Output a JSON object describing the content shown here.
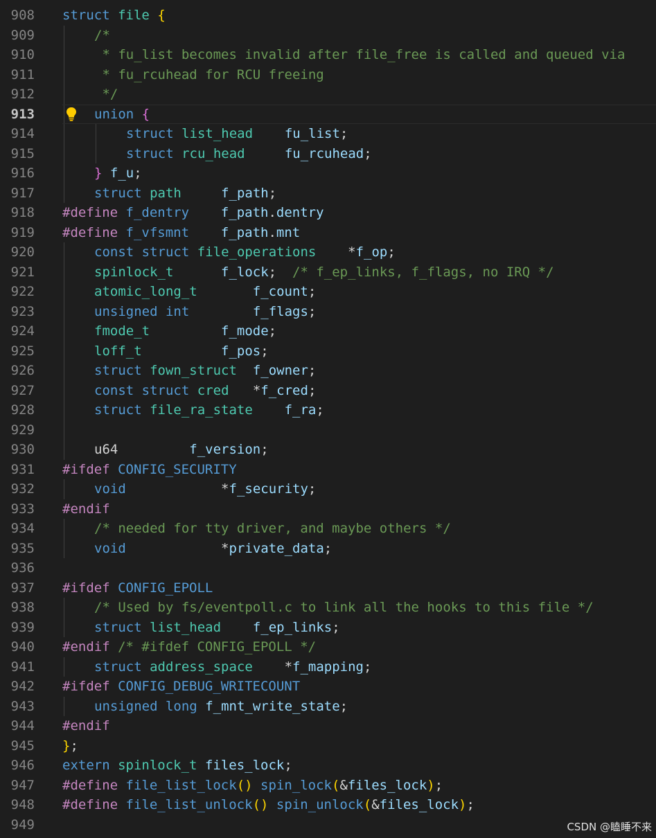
{
  "colors": {
    "background": "#1e1e1e",
    "line_number": "#858585",
    "keyword": "#569cd6",
    "type": "#4ec9b0",
    "identifier": "#9cdcfe",
    "plain": "#d4d4d4",
    "comment": "#6a9955",
    "preprocessor": "#c586c0",
    "function": "#dcdcaa",
    "bracket": "#ffd700",
    "brace_nested": "#da70d6"
  },
  "editor": {
    "current_line": "913",
    "lightbulb_icon": "lightbulb-icon",
    "lines": [
      {
        "n": "908",
        "indent": 0,
        "tokens": [
          [
            "struct",
            "k"
          ],
          [
            " ",
            "p"
          ],
          [
            "file",
            "t"
          ],
          [
            " ",
            "p"
          ],
          [
            "{",
            "b"
          ]
        ]
      },
      {
        "n": "909",
        "indent": 1,
        "tokens": [
          [
            "/*",
            "c"
          ]
        ]
      },
      {
        "n": "910",
        "indent": 1,
        "tokens": [
          [
            " * fu_list becomes invalid after file_free is called and queued via",
            "c"
          ]
        ]
      },
      {
        "n": "911",
        "indent": 1,
        "tokens": [
          [
            " * fu_rcuhead for RCU freeing",
            "c"
          ]
        ]
      },
      {
        "n": "912",
        "indent": 1,
        "tokens": [
          [
            " */",
            "c"
          ]
        ]
      },
      {
        "n": "913",
        "indent": 1,
        "tokens": [
          [
            "union",
            "k"
          ],
          [
            " ",
            "p"
          ],
          [
            "{",
            "m"
          ]
        ]
      },
      {
        "n": "914",
        "indent": 2,
        "tokens": [
          [
            "struct",
            "k"
          ],
          [
            " ",
            "p"
          ],
          [
            "list_head",
            "t"
          ],
          [
            "    ",
            "p"
          ],
          [
            "fu_list",
            "i"
          ],
          [
            ";",
            "p"
          ]
        ]
      },
      {
        "n": "915",
        "indent": 2,
        "tokens": [
          [
            "struct",
            "k"
          ],
          [
            " ",
            "p"
          ],
          [
            "rcu_head",
            "t"
          ],
          [
            "     ",
            "p"
          ],
          [
            "fu_rcuhead",
            "i"
          ],
          [
            ";",
            "p"
          ]
        ]
      },
      {
        "n": "916",
        "indent": 1,
        "tokens": [
          [
            "}",
            "m"
          ],
          [
            " ",
            "p"
          ],
          [
            "f_u",
            "i"
          ],
          [
            ";",
            "p"
          ]
        ]
      },
      {
        "n": "917",
        "indent": 1,
        "tokens": [
          [
            "struct",
            "k"
          ],
          [
            " ",
            "p"
          ],
          [
            "path",
            "t"
          ],
          [
            "     ",
            "p"
          ],
          [
            "f_path",
            "i"
          ],
          [
            ";",
            "p"
          ]
        ]
      },
      {
        "n": "918",
        "indent": 0,
        "tokens": [
          [
            "#define",
            "pp"
          ],
          [
            " ",
            "p"
          ],
          [
            "f_dentry",
            "k"
          ],
          [
            "    ",
            "p"
          ],
          [
            "f_path",
            "i"
          ],
          [
            ".",
            "p"
          ],
          [
            "dentry",
            "i"
          ]
        ]
      },
      {
        "n": "919",
        "indent": 0,
        "tokens": [
          [
            "#define",
            "pp"
          ],
          [
            " ",
            "p"
          ],
          [
            "f_vfsmnt",
            "k"
          ],
          [
            "    ",
            "p"
          ],
          [
            "f_path",
            "i"
          ],
          [
            ".",
            "p"
          ],
          [
            "mnt",
            "i"
          ]
        ]
      },
      {
        "n": "920",
        "indent": 1,
        "tokens": [
          [
            "const",
            "k"
          ],
          [
            " ",
            "p"
          ],
          [
            "struct",
            "k"
          ],
          [
            " ",
            "p"
          ],
          [
            "file_operations",
            "t"
          ],
          [
            "    ",
            "p"
          ],
          [
            "*",
            "p"
          ],
          [
            "f_op",
            "i"
          ],
          [
            ";",
            "p"
          ]
        ]
      },
      {
        "n": "921",
        "indent": 1,
        "tokens": [
          [
            "spinlock_t",
            "t"
          ],
          [
            "      ",
            "p"
          ],
          [
            "f_lock",
            "i"
          ],
          [
            ";",
            "p"
          ],
          [
            "  ",
            "p"
          ],
          [
            "/* f_ep_links, f_flags, no IRQ */",
            "c"
          ]
        ]
      },
      {
        "n": "922",
        "indent": 1,
        "tokens": [
          [
            "atomic_long_t",
            "t"
          ],
          [
            "       ",
            "p"
          ],
          [
            "f_count",
            "i"
          ],
          [
            ";",
            "p"
          ]
        ]
      },
      {
        "n": "923",
        "indent": 1,
        "tokens": [
          [
            "unsigned",
            "k"
          ],
          [
            " ",
            "p"
          ],
          [
            "int",
            "k"
          ],
          [
            "        ",
            "p"
          ],
          [
            "f_flags",
            "i"
          ],
          [
            ";",
            "p"
          ]
        ]
      },
      {
        "n": "924",
        "indent": 1,
        "tokens": [
          [
            "fmode_t",
            "t"
          ],
          [
            "         ",
            "p"
          ],
          [
            "f_mode",
            "i"
          ],
          [
            ";",
            "p"
          ]
        ]
      },
      {
        "n": "925",
        "indent": 1,
        "tokens": [
          [
            "loff_t",
            "t"
          ],
          [
            "          ",
            "p"
          ],
          [
            "f_pos",
            "i"
          ],
          [
            ";",
            "p"
          ]
        ]
      },
      {
        "n": "926",
        "indent": 1,
        "tokens": [
          [
            "struct",
            "k"
          ],
          [
            " ",
            "p"
          ],
          [
            "fown_struct",
            "t"
          ],
          [
            "  ",
            "p"
          ],
          [
            "f_owner",
            "i"
          ],
          [
            ";",
            "p"
          ]
        ]
      },
      {
        "n": "927",
        "indent": 1,
        "tokens": [
          [
            "const",
            "k"
          ],
          [
            " ",
            "p"
          ],
          [
            "struct",
            "k"
          ],
          [
            " ",
            "p"
          ],
          [
            "cred",
            "t"
          ],
          [
            "   ",
            "p"
          ],
          [
            "*",
            "p"
          ],
          [
            "f_cred",
            "i"
          ],
          [
            ";",
            "p"
          ]
        ]
      },
      {
        "n": "928",
        "indent": 1,
        "tokens": [
          [
            "struct",
            "k"
          ],
          [
            " ",
            "p"
          ],
          [
            "file_ra_state",
            "t"
          ],
          [
            "    ",
            "p"
          ],
          [
            "f_ra",
            "i"
          ],
          [
            ";",
            "p"
          ]
        ]
      },
      {
        "n": "929",
        "indent": 1,
        "tokens": []
      },
      {
        "n": "930",
        "indent": 1,
        "tokens": [
          [
            "u64",
            "p"
          ],
          [
            "         ",
            "p"
          ],
          [
            "f_version",
            "i"
          ],
          [
            ";",
            "p"
          ]
        ]
      },
      {
        "n": "931",
        "indent": 0,
        "tokens": [
          [
            "#ifdef",
            "pp"
          ],
          [
            " ",
            "p"
          ],
          [
            "CONFIG_SECURITY",
            "k"
          ]
        ]
      },
      {
        "n": "932",
        "indent": 1,
        "tokens": [
          [
            "void",
            "k"
          ],
          [
            "            ",
            "p"
          ],
          [
            "*",
            "p"
          ],
          [
            "f_security",
            "i"
          ],
          [
            ";",
            "p"
          ]
        ]
      },
      {
        "n": "933",
        "indent": 0,
        "tokens": [
          [
            "#endif",
            "pp"
          ]
        ]
      },
      {
        "n": "934",
        "indent": 1,
        "tokens": [
          [
            "/* needed for tty driver, and maybe others */",
            "c"
          ]
        ]
      },
      {
        "n": "935",
        "indent": 1,
        "tokens": [
          [
            "void",
            "k"
          ],
          [
            "            ",
            "p"
          ],
          [
            "*",
            "p"
          ],
          [
            "private_data",
            "i"
          ],
          [
            ";",
            "p"
          ]
        ]
      },
      {
        "n": "936",
        "indent": 0,
        "tokens": []
      },
      {
        "n": "937",
        "indent": 0,
        "tokens": [
          [
            "#ifdef",
            "pp"
          ],
          [
            " ",
            "p"
          ],
          [
            "CONFIG_EPOLL",
            "k"
          ]
        ]
      },
      {
        "n": "938",
        "indent": 1,
        "tokens": [
          [
            "/* Used by fs/eventpoll.c to link all the hooks to this file */",
            "c"
          ]
        ]
      },
      {
        "n": "939",
        "indent": 1,
        "tokens": [
          [
            "struct",
            "k"
          ],
          [
            " ",
            "p"
          ],
          [
            "list_head",
            "t"
          ],
          [
            "    ",
            "p"
          ],
          [
            "f_ep_links",
            "i"
          ],
          [
            ";",
            "p"
          ]
        ]
      },
      {
        "n": "940",
        "indent": 0,
        "tokens": [
          [
            "#endif",
            "pp"
          ],
          [
            " ",
            "p"
          ],
          [
            "/* #ifdef CONFIG_EPOLL */",
            "c"
          ]
        ]
      },
      {
        "n": "941",
        "indent": 1,
        "tokens": [
          [
            "struct",
            "k"
          ],
          [
            " ",
            "p"
          ],
          [
            "address_space",
            "t"
          ],
          [
            "    ",
            "p"
          ],
          [
            "*",
            "p"
          ],
          [
            "f_mapping",
            "i"
          ],
          [
            ";",
            "p"
          ]
        ]
      },
      {
        "n": "942",
        "indent": 0,
        "tokens": [
          [
            "#ifdef",
            "pp"
          ],
          [
            " ",
            "p"
          ],
          [
            "CONFIG_DEBUG_WRITECOUNT",
            "k"
          ]
        ]
      },
      {
        "n": "943",
        "indent": 1,
        "tokens": [
          [
            "unsigned",
            "k"
          ],
          [
            " ",
            "p"
          ],
          [
            "long",
            "k"
          ],
          [
            " ",
            "p"
          ],
          [
            "f_mnt_write_state",
            "i"
          ],
          [
            ";",
            "p"
          ]
        ]
      },
      {
        "n": "944",
        "indent": 0,
        "tokens": [
          [
            "#endif",
            "pp"
          ]
        ]
      },
      {
        "n": "945",
        "indent": 0,
        "tokens": [
          [
            "}",
            "b"
          ],
          [
            ";",
            "p"
          ]
        ]
      },
      {
        "n": "946",
        "indent": 0,
        "tokens": [
          [
            "extern",
            "k"
          ],
          [
            " ",
            "p"
          ],
          [
            "spinlock_t",
            "t"
          ],
          [
            " ",
            "p"
          ],
          [
            "files_lock",
            "i"
          ],
          [
            ";",
            "p"
          ]
        ]
      },
      {
        "n": "947",
        "indent": 0,
        "tokens": [
          [
            "#define",
            "pp"
          ],
          [
            " ",
            "p"
          ],
          [
            "file_list_lock",
            "k"
          ],
          [
            "()",
            "b"
          ],
          [
            " ",
            "p"
          ],
          [
            "spin_lock",
            "k"
          ],
          [
            "(",
            "b"
          ],
          [
            "&",
            "p"
          ],
          [
            "files_lock",
            "i"
          ],
          [
            ")",
            "b"
          ],
          [
            ";",
            "p"
          ]
        ]
      },
      {
        "n": "948",
        "indent": 0,
        "tokens": [
          [
            "#define",
            "pp"
          ],
          [
            " ",
            "p"
          ],
          [
            "file_list_unlock",
            "k"
          ],
          [
            "()",
            "b"
          ],
          [
            " ",
            "p"
          ],
          [
            "spin_unlock",
            "k"
          ],
          [
            "(",
            "b"
          ],
          [
            "&",
            "p"
          ],
          [
            "files_lock",
            "i"
          ],
          [
            ")",
            "b"
          ],
          [
            ";",
            "p"
          ]
        ]
      },
      {
        "n": "949",
        "indent": 0,
        "tokens": []
      }
    ]
  },
  "watermark": "CSDN @瞌睡不来"
}
